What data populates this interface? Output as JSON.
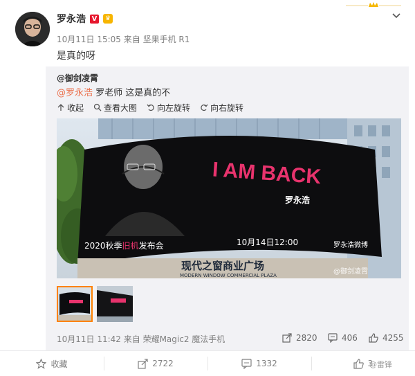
{
  "post": {
    "author": "罗永浩",
    "verified_badge": "V",
    "time_source": "10月11日 15:05 来自 坚果手机 R1",
    "text": "是真的呀"
  },
  "repost": {
    "author": "@御剑凌霄",
    "mention": "@罗永浩",
    "text_after_mention": " 罗老师 这是真的不",
    "tools": {
      "collapse": "收起",
      "view_large": "查看大图",
      "rotate_left": "向左旋转",
      "rotate_right": "向右旋转"
    },
    "image": {
      "headline": "I AM BACK",
      "name": "罗永浩",
      "event_line": "2020秋季旧机发布会",
      "event_year_season": "2020秋季",
      "event_highlight": "旧机",
      "event_rest": "发布会",
      "event_date": "10月14日12:00",
      "host_text": "罗永浩微博",
      "building_sign": "现代之窗商业广场",
      "building_sign_en": "MODERN WINDOW COMMERCIAL PLAZA",
      "watermark": "@御剑凌霄"
    },
    "time_source": "10月11日 11:42 来自 荣耀Magic2 魔法手机",
    "repost_count": "2820",
    "comment_count": "406",
    "like_count": "4255"
  },
  "actions": {
    "favorite": "收藏",
    "repost": "2722",
    "comment": "1332",
    "like": "3"
  },
  "watermark_bottom": "@雷锋",
  "colors": {
    "mention": "#eb7350",
    "headline": "#e8336d",
    "highlight": "#e8336d",
    "active_thumb_border": "#ff8200",
    "badge_red": "#e6162d"
  }
}
